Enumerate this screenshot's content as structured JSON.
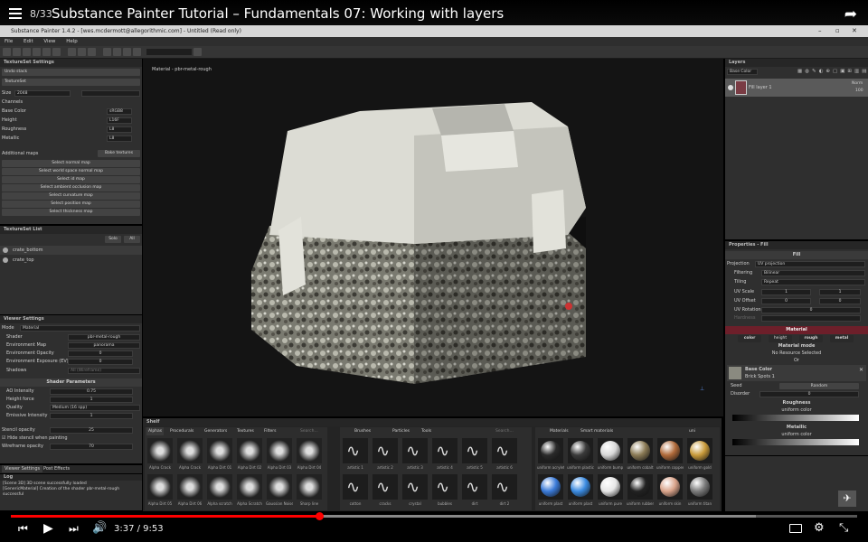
{
  "youtube": {
    "playlist_count": "8/33",
    "title": "Substance Painter Tutorial – Fundamentals 07: Working with layers",
    "time": "3:37 / 9:53",
    "progress": 0.366
  },
  "app": {
    "window_title": "Substance Painter 1.4.2 - [wes.mcdermott@allegorithmic.com] - Untitled (Read only)",
    "menu": [
      "File",
      "Edit",
      "View",
      "Help"
    ]
  },
  "texture_set_settings": {
    "header": "TextureSet Settings",
    "undo": "Undo stack",
    "textureset": "TextureSet",
    "size_label": "Size",
    "size_value": "2048",
    "channels_label": "Channels",
    "channels": [
      {
        "name": "Base Color",
        "value": "sRGB8"
      },
      {
        "name": "Height",
        "value": "L16F"
      },
      {
        "name": "Roughness",
        "value": "L8"
      },
      {
        "name": "Metallic",
        "value": "L8"
      }
    ],
    "additional_maps": "Additional maps",
    "bake": "Bake textures",
    "maps": [
      "Select normal map",
      "Select world space normal map",
      "Select id map",
      "Select ambient occlusion map",
      "Select curvature map",
      "Select position map",
      "Select thickness map"
    ]
  },
  "texture_set_list": {
    "header": "TextureSet List",
    "solo": "Solo",
    "all": "All",
    "items": [
      "crate_bottom",
      "crate_top"
    ]
  },
  "viewer_settings": {
    "header": "Viewer Settings",
    "mode_label": "Mode",
    "mode_value": "Material",
    "rows": [
      {
        "label": "Shader",
        "value": "pbr-metal-rough"
      },
      {
        "label": "Environment Map",
        "value": "panorama"
      },
      {
        "label": "Environment Opacity",
        "value": "0"
      },
      {
        "label": "Environment Exposure (EV)",
        "value": "0"
      },
      {
        "label": "Shadows",
        "value": "All (Wireframe)"
      }
    ],
    "shader_params": "Shader Parameters",
    "params": [
      {
        "label": "AO Intensity",
        "value": "0.75"
      },
      {
        "label": "Height force",
        "value": "1"
      },
      {
        "label": "Quality",
        "value": "Medium (16 spp)"
      },
      {
        "label": "Emissive Intensity",
        "value": "1"
      }
    ],
    "stencil_label": "Stencil opacity",
    "stencil_value": "25",
    "hide_stencil": "Hide stencil when painting",
    "wire_label": "Wireframe opacity",
    "wire_value": "70"
  },
  "bottom_tabs": [
    "Viewer Settings",
    "Post Effects"
  ],
  "log": {
    "header": "Log",
    "lines": [
      "[Scene 3D] 3D scene successfully loaded",
      "[GenericMaterial] Creation of the shader pbr-metal-rough",
      "successful"
    ]
  },
  "viewport": {
    "label": "Material - pbr-metal-rough"
  },
  "shelf": {
    "header": "Shelf",
    "tabs": [
      "Alphas",
      "Procedurals",
      "Generators",
      "Textures",
      "Filters"
    ],
    "search": "Search...",
    "alphas": [
      "Alpha Crack",
      "Alpha Crack",
      "Alpha Dirt 01",
      "Alpha Dirt 02",
      "Alpha Dirt 03",
      "Alpha Dirt 04",
      "Alpha Dirt 05",
      "Alpha Dirt 06",
      "Alpha scratch",
      "Alpha Scratch",
      "Gaussian Noise",
      "Sharp line"
    ],
    "brush_tabs": [
      "Brushes",
      "Particles",
      "Tools"
    ],
    "brushes": [
      "artistic 1",
      "artistic 2",
      "artistic 3",
      "artistic 4",
      "artistic 5",
      "artistic 6",
      "cotton",
      "cracks",
      "crystal",
      "bubbles",
      "dirt",
      "dirt 2"
    ],
    "mat_tabs": [
      "Materials",
      "Smart materials"
    ],
    "mat_search": "uni",
    "materials": [
      "uniform acrylet",
      "uniform plastic",
      "uniform bump",
      "uniform cobalt",
      "uniform copper",
      "uniform gold",
      "uniform plast",
      "uniform plast",
      "uniform pure",
      "uniform rubber",
      "uniform skin",
      "uniform titan"
    ]
  },
  "layers": {
    "header": "Layers",
    "channel": "Base Color",
    "layer_name": "Fill layer 1",
    "blend": "Norm",
    "opacity": "100"
  },
  "properties": {
    "header": "Properties - Fill",
    "fill": "Fill",
    "rows": [
      {
        "label": "Projection",
        "value": "UV projection"
      },
      {
        "label": "Filtering",
        "value": "Bilinear"
      },
      {
        "label": "Tiling",
        "value": "Repeat"
      },
      {
        "label": "UV Scale",
        "value": "1"
      },
      {
        "label": "UV Offset",
        "value": "0"
      },
      {
        "label": "UV Rotation",
        "value": "0"
      },
      {
        "label": "Hardness",
        "value": ""
      }
    ],
    "material": "Material",
    "chips": [
      "color",
      "height",
      "rough",
      "metal"
    ],
    "material_mode": "Material mode",
    "no_resource": "No Resource Selected",
    "or": "Or",
    "base_color": "Base Color",
    "base_color_sub": "Brick Spots 1",
    "seed": "Seed",
    "seed_value": "Random",
    "disorder": "Disorder",
    "disorder_value": "0",
    "roughness": "Roughness",
    "metallic": "Metallic",
    "uniform_color": "uniform color"
  },
  "colors": {
    "accent_red": "#ff0000",
    "material_header": "#6d1f2a"
  }
}
